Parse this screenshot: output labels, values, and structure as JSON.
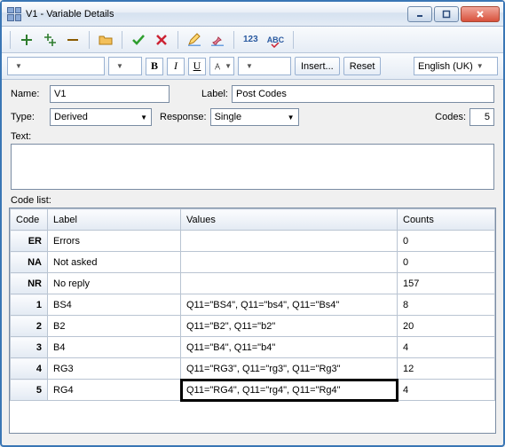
{
  "window": {
    "title": "V1 - Variable Details"
  },
  "toolbar": {
    "insert_label": "Insert...",
    "reset_label": "Reset",
    "language_label": "English (UK)",
    "num123_label": "123",
    "abc_label": "ABC"
  },
  "form": {
    "name_label": "Name:",
    "name_value": "V1",
    "label_label": "Label:",
    "label_value": "Post Codes",
    "type_label": "Type:",
    "type_value": "Derived",
    "response_label": "Response:",
    "response_value": "Single",
    "codes_label": "Codes:",
    "codes_value": "5",
    "text_label": "Text:"
  },
  "codelist": {
    "label": "Code list:",
    "headers": {
      "code": "Code",
      "label": "Label",
      "values": "Values",
      "counts": "Counts"
    },
    "rows": [
      {
        "code": "ER",
        "label": "Errors",
        "values": "",
        "counts": "0"
      },
      {
        "code": "NA",
        "label": "Not asked",
        "values": "",
        "counts": "0"
      },
      {
        "code": "NR",
        "label": "No reply",
        "values": "",
        "counts": "157"
      },
      {
        "code": "1",
        "label": "BS4",
        "values": "Q11=\"BS4\", Q11=\"bs4\", Q11=\"Bs4\"",
        "counts": "8"
      },
      {
        "code": "2",
        "label": "B2",
        "values": "Q11=\"B2\", Q11=\"b2\"",
        "counts": "20"
      },
      {
        "code": "3",
        "label": "B4",
        "values": "Q11=\"B4\", Q11=\"b4\"",
        "counts": "4"
      },
      {
        "code": "4",
        "label": "RG3",
        "values": "Q11=\"RG3\", Q11=\"rg3\", Q11=\"Rg3\"",
        "counts": "12"
      },
      {
        "code": "5",
        "label": "RG4",
        "values": "Q11=\"RG4\", Q11=\"rg4\", Q11=\"Rg4\"",
        "counts": "4",
        "highlight": true
      }
    ]
  }
}
